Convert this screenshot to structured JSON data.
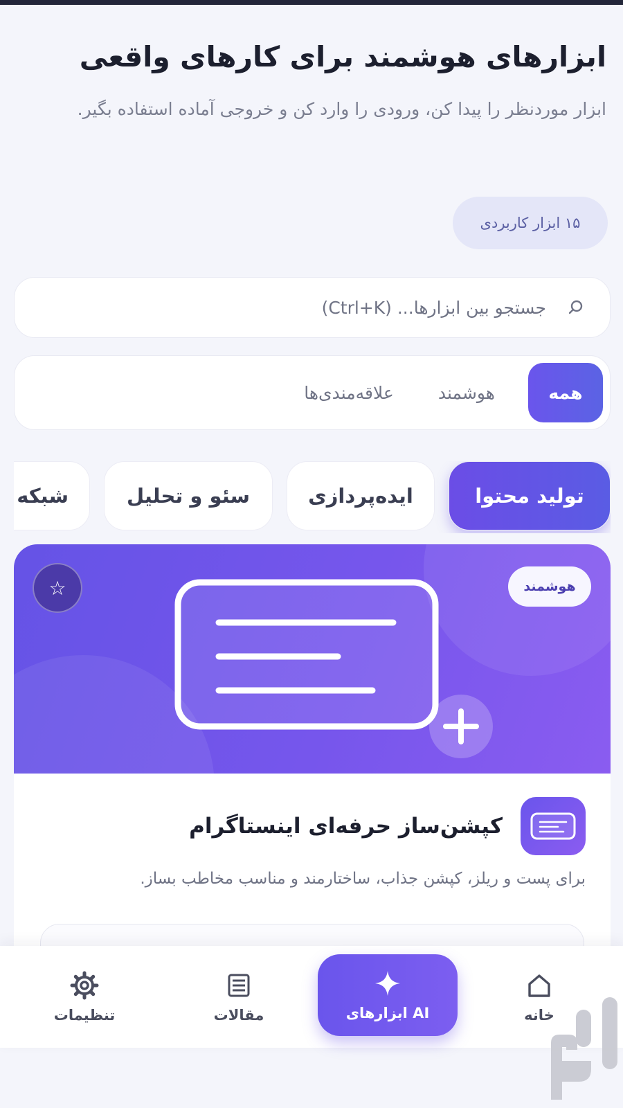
{
  "header": {
    "title": "ابزارهای هوشمند برای کارهای واقعی",
    "subtitle": "ابزار موردنظر را پیدا کن، ورودی را وارد کن و خروجی آماده استفاده بگیر.",
    "tool_count_badge": "۱۵ ابزار کاربردی"
  },
  "search": {
    "placeholder": "جستجو بین ابزارها... (Ctrl+K)",
    "icon": "search-icon"
  },
  "filters": {
    "tabs": [
      {
        "label": "همه",
        "active": true
      },
      {
        "label": "هوشمند",
        "active": false
      },
      {
        "label": "علاقه‌مندی‌ها",
        "active": false
      }
    ]
  },
  "categories": {
    "chips": [
      {
        "label": "تولید محتوا",
        "active": true
      },
      {
        "label": "ایده‌پردازی",
        "active": false
      },
      {
        "label": "سئو و تحلیل",
        "active": false
      },
      {
        "label": "شبکه",
        "active": false
      }
    ]
  },
  "tool_card": {
    "tag": "هوشمند",
    "favorite_icon": "star-icon",
    "title": "کپشن‌ساز حرفه‌ای اینستاگرام",
    "description": "برای پست و ریلز، کپشن جذاب، ساختارمند و مناسب مخاطب بساز."
  },
  "bottom_nav": {
    "items": [
      {
        "label": "خانه",
        "icon": "home-icon",
        "active": false
      },
      {
        "label": "ابزارهای AI",
        "icon": "sparkle-icon",
        "active": true
      },
      {
        "label": "مقالات",
        "icon": "list-icon",
        "active": false
      },
      {
        "label": "تنظیمات",
        "icon": "gear-icon",
        "active": false
      }
    ]
  },
  "colors": {
    "accent": "#6a55ec",
    "background": "#f4f5fb"
  }
}
